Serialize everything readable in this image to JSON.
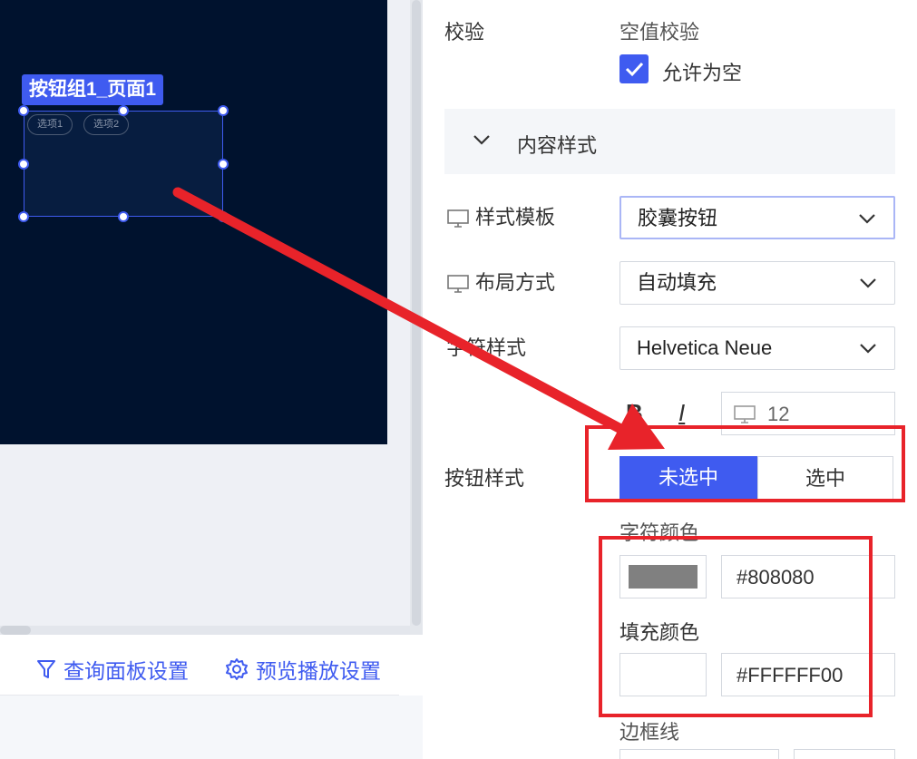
{
  "canvas": {
    "selection_label": "按钮组1_页面1",
    "chips": [
      "选项1",
      "选项2"
    ]
  },
  "bottom_bar": {
    "query_panel_settings": "查询面板设置",
    "preview_play_settings": "预览播放设置"
  },
  "panel": {
    "validation_label": "校验",
    "empty_check_label": "空值校验",
    "allow_empty_label": "允许为空",
    "allow_empty_checked": true,
    "content_style_section": "内容样式",
    "style_template_label": "样式模板",
    "style_template_value": "胶囊按钮",
    "layout_label": "布局方式",
    "layout_value": "自动填充",
    "font_style_label": "字符样式",
    "font_value": "Helvetica Neue",
    "bold_label": "B",
    "italic_label": "I",
    "font_size_value": "12",
    "button_style_label": "按钮样式",
    "seg_unselected": "未选中",
    "seg_selected": "选中",
    "text_color_label": "字符颜色",
    "text_color_hex": "#808080",
    "fill_color_label": "填充颜色",
    "fill_color_hex": "#FFFFFF00",
    "border_label": "边框线"
  },
  "colors": {
    "accent": "#3f5bf0",
    "canvas_bg": "#00122e",
    "annotation_red": "#e8232a",
    "text_swatch": "#808080"
  }
}
